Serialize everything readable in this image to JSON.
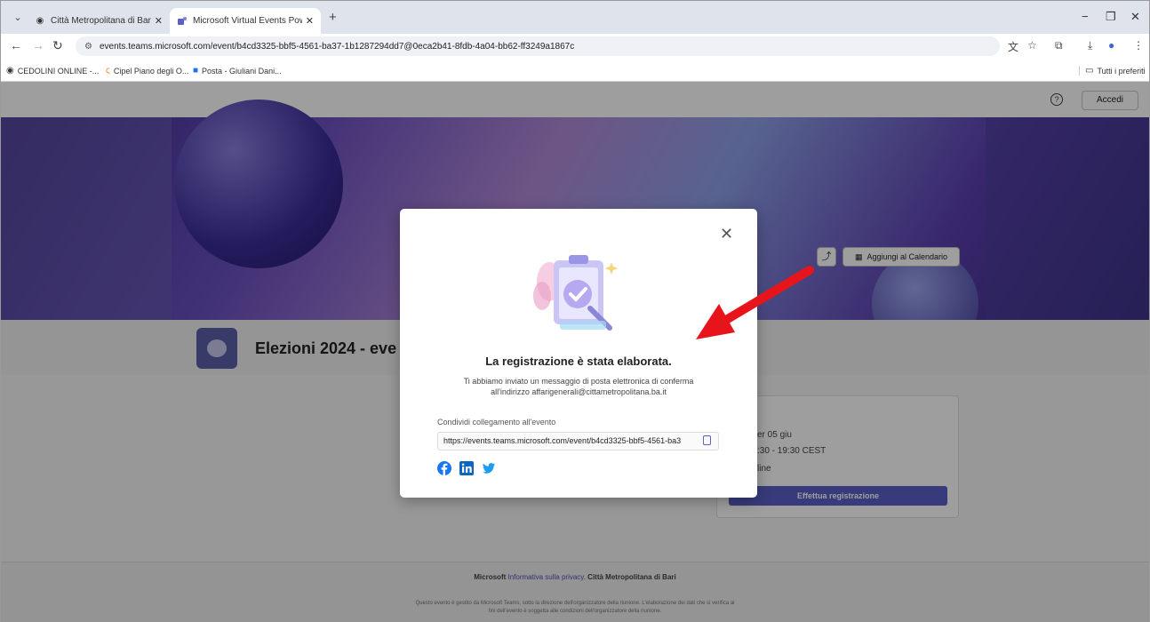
{
  "browser": {
    "tabs": [
      {
        "title": "Città Metropolitana di Bari - Se",
        "active": false
      },
      {
        "title": "Microsoft Virtual Events Power",
        "active": true
      }
    ],
    "new_tab": "+",
    "window_controls": {
      "minimize": "−",
      "restore": "❐",
      "close": "✕"
    },
    "url": "events.teams.microsoft.com/event/b4cd3325-bbf5-4561-ba37-1b1287294dd7@0eca2b41-8fdb-4a04-bb62-ff3249a1867c",
    "bookmarks": [
      {
        "label": "CEDOLINI ONLINE -..."
      },
      {
        "label": "Cipel Piano degli O..."
      },
      {
        "label": "Posta - Giuliani Dani..."
      }
    ],
    "all_bookmarks": "Tutti i preferiti"
  },
  "page": {
    "login_label": "Accedi",
    "help_icon": "?",
    "event_title": "Elezioni 2024 - eve",
    "add_calendar_label": "Aggiungi al Calendario",
    "card": {
      "date": "er 05 giu",
      "time": ":30 - 19:30 CEST",
      "mode": "line",
      "register_label": "Effettua registrazione"
    },
    "footer": {
      "microsoft": "Microsoft",
      "privacy": "Informativa sulla privacy.",
      "org": "Città Metropolitana di Bari",
      "disclaimer_1": "Questo evento è gestito da Microsoft Teams, sotto la direzione dell'organizzatore della riunione. L'elaborazione dei dati che si verifica ai",
      "disclaimer_2": "fini dell'evento è soggetta alle condizioni dell'organizzatore della riunione."
    }
  },
  "dialog": {
    "close_label": "✕",
    "title": "La registrazione è stata elaborata.",
    "message_1": "Ti abbiamo inviato un messaggio di posta elettronica di conferma",
    "message_2": "all'indirizzo affarigenerali@cittametropolitana.ba.it",
    "share_label": "Condividi collegamento all'evento",
    "share_link": "https://events.teams.microsoft.com/event/b4cd3325-bbf5-4561-ba3",
    "social": [
      "facebook-icon",
      "linkedin-icon",
      "twitter-icon"
    ]
  },
  "colors": {
    "accent": "#5b5fc7",
    "annotation_arrow": "#e8141c"
  }
}
